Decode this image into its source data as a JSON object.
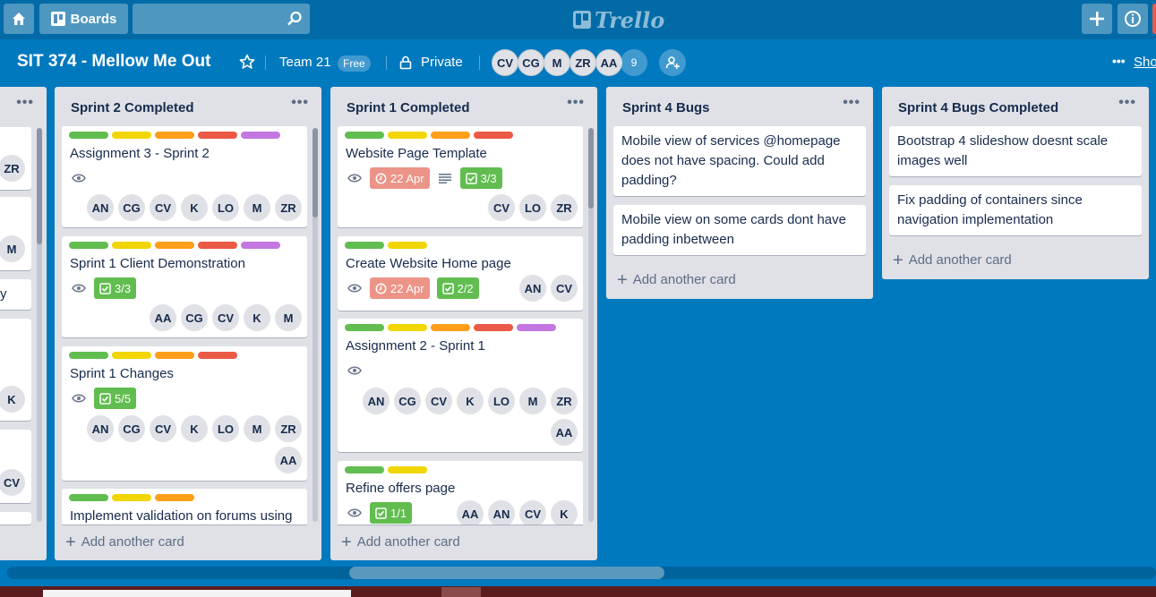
{
  "topbar": {
    "boards_label": "Boards",
    "logo_text": "Trello"
  },
  "board": {
    "title": "SIT 374 - Mellow Me Out",
    "team_name": "Team 21",
    "team_badge": "Free",
    "visibility": "Private",
    "members": [
      "CV",
      "CG",
      "M",
      "ZR",
      "AA"
    ],
    "member_overflow": "9",
    "show_menu_label": "Sho"
  },
  "colors": {
    "green": "#61bd4f",
    "yellow": "#f2d600",
    "orange": "#ff9f1a",
    "red": "#eb5a46",
    "purple": "#c377e0",
    "board_bg": "#0079bf"
  },
  "partial_list": {
    "members": [
      "ZR",
      "M",
      "K",
      "CV"
    ],
    "text_fragment": "y"
  },
  "lists": [
    {
      "title": "Sprint 2 Completed",
      "add_label": "Add another card",
      "cards": [
        {
          "title": "Assignment 3 - Sprint 2",
          "labels": [
            "green",
            "yellow",
            "orange",
            "red",
            "purple"
          ],
          "watch": true,
          "members": [
            "AN",
            "CG",
            "CV",
            "K",
            "LO",
            "M",
            "ZR"
          ]
        },
        {
          "title": "Sprint 1 Client Demonstration",
          "labels": [
            "green",
            "yellow",
            "orange",
            "red",
            "purple"
          ],
          "watch": true,
          "checklist": "3/3",
          "members": [
            "AA",
            "CG",
            "CV",
            "K",
            "M"
          ]
        },
        {
          "title": "Sprint 1 Changes",
          "labels": [
            "green",
            "yellow",
            "orange",
            "red"
          ],
          "watch": true,
          "checklist": "5/5",
          "members": [
            "AN",
            "CG",
            "CV",
            "K",
            "LO",
            "M",
            "ZR",
            "AA"
          ]
        },
        {
          "title": "Implement validation on forums using",
          "labels": [
            "green",
            "yellow",
            "orange"
          ]
        }
      ]
    },
    {
      "title": "Sprint 1 Completed",
      "add_label": "Add another card",
      "cards": [
        {
          "title": "Website Page Template",
          "labels": [
            "green",
            "yellow",
            "orange",
            "red"
          ],
          "watch": true,
          "due": "22 Apr",
          "description": true,
          "checklist": "3/3",
          "members": [
            "CV",
            "LO",
            "ZR"
          ]
        },
        {
          "title": "Create Website Home page",
          "labels": [
            "green",
            "yellow"
          ],
          "watch": true,
          "due": "22 Apr",
          "checklist": "2/2",
          "members": [
            "AN",
            "CV"
          ]
        },
        {
          "title": "Assignment 2 - Sprint 1",
          "labels": [
            "green",
            "yellow",
            "orange",
            "red",
            "purple"
          ],
          "watch": true,
          "members": [
            "AN",
            "CG",
            "CV",
            "K",
            "LO",
            "M",
            "ZR",
            "AA"
          ]
        },
        {
          "title": "Refine offers page",
          "labels": [
            "green",
            "yellow"
          ],
          "watch": true,
          "checklist": "1/1",
          "members": [
            "AA",
            "AN",
            "CV",
            "K"
          ]
        }
      ]
    },
    {
      "title": "Sprint 4 Bugs",
      "add_label": "Add another card",
      "cards": [
        {
          "title": "Mobile view of services @homepage does not have spacing. Could add padding?"
        },
        {
          "title": "Mobile view on some cards dont have padding inbetween"
        }
      ]
    },
    {
      "title": "Sprint 4 Bugs Completed",
      "add_label": "Add another card",
      "cards": [
        {
          "title": "Bootstrap 4 slideshow doesnt scale images well"
        },
        {
          "title": "Fix padding of containers since navigation implementation"
        }
      ]
    }
  ]
}
